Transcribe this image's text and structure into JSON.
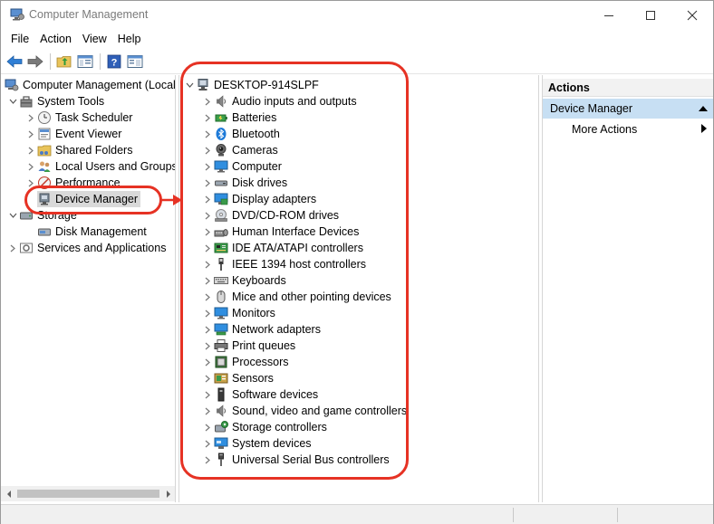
{
  "window": {
    "title": "Computer Management"
  },
  "menu": [
    "File",
    "Action",
    "View",
    "Help"
  ],
  "left_tree": {
    "root": "Computer Management (Local",
    "system_tools": "System Tools",
    "task_scheduler": "Task Scheduler",
    "event_viewer": "Event Viewer",
    "shared_folders": "Shared Folders",
    "local_users": "Local Users and Groups",
    "performance": "Performance",
    "device_manager": "Device Manager",
    "storage": "Storage",
    "disk_management": "Disk Management",
    "services": "Services and Applications"
  },
  "device_tree": {
    "computer_name": "DESKTOP-914SLPF",
    "items": [
      {
        "label": "Audio inputs and outputs",
        "icon": "speaker-icon"
      },
      {
        "label": "Batteries",
        "icon": "battery-icon"
      },
      {
        "label": "Bluetooth",
        "icon": "bluetooth-icon"
      },
      {
        "label": "Cameras",
        "icon": "camera-icon"
      },
      {
        "label": "Computer",
        "icon": "monitor-icon"
      },
      {
        "label": "Disk drives",
        "icon": "disk-drive-icon"
      },
      {
        "label": "Display adapters",
        "icon": "display-adapter-icon"
      },
      {
        "label": "DVD/CD-ROM drives",
        "icon": "dvd-icon"
      },
      {
        "label": "Human Interface Devices",
        "icon": "hid-icon"
      },
      {
        "label": "IDE ATA/ATAPI controllers",
        "icon": "ide-icon"
      },
      {
        "label": "IEEE 1394 host controllers",
        "icon": "firewire-icon"
      },
      {
        "label": "Keyboards",
        "icon": "keyboard-icon"
      },
      {
        "label": "Mice and other pointing devices",
        "icon": "mouse-icon"
      },
      {
        "label": "Monitors",
        "icon": "monitor-icon"
      },
      {
        "label": "Network adapters",
        "icon": "network-icon"
      },
      {
        "label": "Print queues",
        "icon": "printer-icon"
      },
      {
        "label": "Processors",
        "icon": "processor-icon"
      },
      {
        "label": "Sensors",
        "icon": "sensor-icon"
      },
      {
        "label": "Software devices",
        "icon": "software-device-icon"
      },
      {
        "label": "Sound, video and game controllers",
        "icon": "speaker-icon"
      },
      {
        "label": "Storage controllers",
        "icon": "storage-controller-icon"
      },
      {
        "label": "System devices",
        "icon": "system-device-icon"
      },
      {
        "label": "Universal Serial Bus controllers",
        "icon": "usb-icon"
      }
    ]
  },
  "actions": {
    "header": "Actions",
    "section": "Device Manager",
    "more": "More Actions"
  },
  "colors": {
    "selection": "#d9d9d9",
    "actions_section": "#c7dff3",
    "annotation": "#e63224",
    "window_bg": "#ffffff"
  }
}
